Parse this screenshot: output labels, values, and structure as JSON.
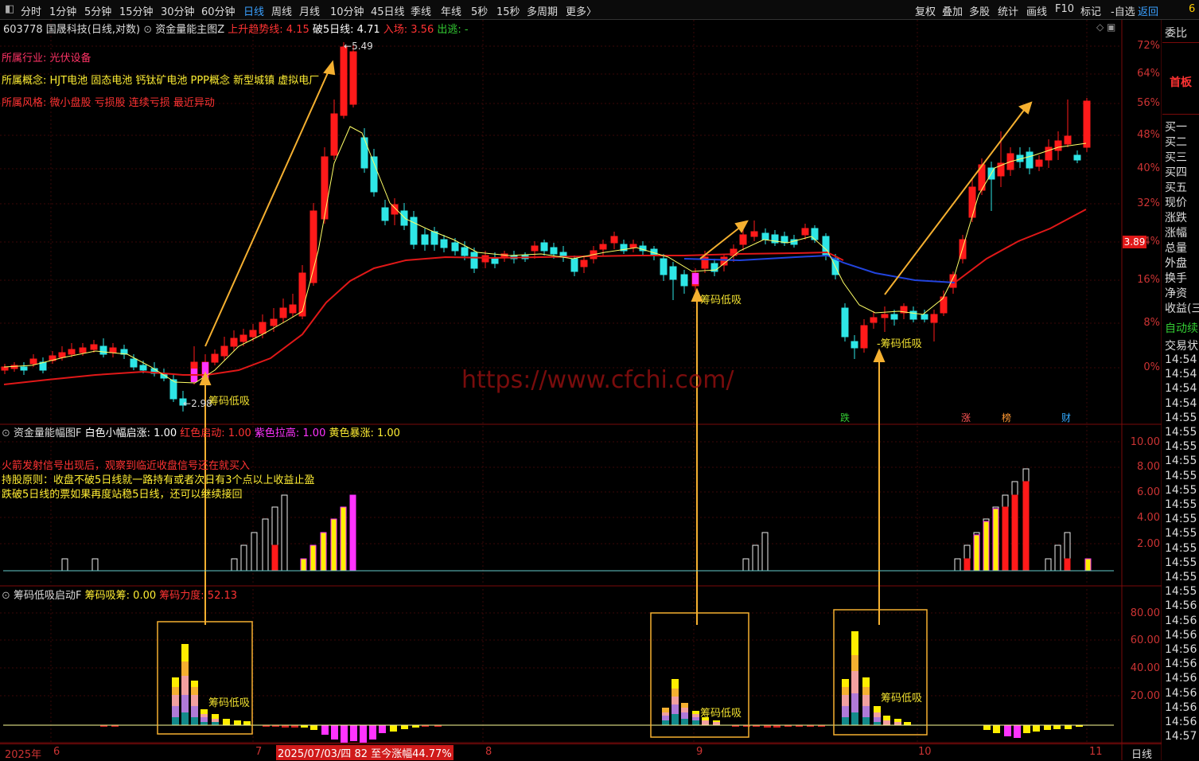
{
  "toolbar": {
    "left_icon": "◧",
    "periods": [
      "分时",
      "1分钟",
      "5分钟",
      "15分钟",
      "30分钟",
      "60分钟",
      "日线",
      "周线",
      "月线",
      "10分钟",
      "45日线",
      "季线",
      "年线",
      "5秒",
      "15秒",
      "多周期",
      "更多〉"
    ],
    "active_period": "日线",
    "right_items": [
      "复权",
      "叠加",
      "多股",
      "统计",
      "画线",
      "F10",
      "标记",
      "-自选",
      "返回"
    ],
    "corner": "6"
  },
  "main_panel": {
    "stock": "603778 国晟科技(日线,对数)",
    "indicator_name": "资金量能主图Z",
    "up_trend": "上升趋势线: 4.15",
    "break5": "破5日线: 4.71",
    "entry": "入场: 3.56",
    "exit": "出逃: -",
    "industry_label": "所属行业:",
    "industry_value": "光伏设备",
    "concept_label": "所属概念:",
    "concept_value": "HJT电池 固态电池 钙钛矿电池 PPP概念 新型城镇 虚拟电厂",
    "style_label": "所属风格:",
    "style_value": "微小盘股 亏损股 连续亏损 最近异动",
    "high_label": "5.49",
    "low_label": "2.98",
    "signal_label": "筹码低吸",
    "signal_label_dash": "-筹码低吸",
    "price_tag": "3.89",
    "y_axis": [
      "72%",
      "64%",
      "56%",
      "48%",
      "40%",
      "32%",
      "24%",
      "16%",
      "8%",
      "0%"
    ],
    "event_tags": [
      "跌",
      "涨",
      "榜",
      "财"
    ],
    "watermark": "https://www.cfchi.com/"
  },
  "volume_panel": {
    "title": "资金量能幅图F",
    "white": "白色小幅启涨: 1.00",
    "red": "红色启动: 1.00",
    "purple": "紫色拉高: 1.00",
    "yellow": "黄色暴涨: 1.00",
    "note1": "火箭发射信号出现后，观察到临近收盘信号还在就买入",
    "note2": "持股原则：收盘不破5日线就一路持有或者次日有3个点以上收益止盈",
    "note3": "跌破5日线的票如果再度站稳5日线，还可以继续接回",
    "y_axis": [
      "10.00",
      "8.00",
      "6.00",
      "4.00",
      "2.00"
    ]
  },
  "chip_panel": {
    "title": "筹码低吸启动F",
    "absorb": "筹码吸筹: 0.00",
    "power": "筹码力度: 52.13",
    "y_axis": [
      "80.00",
      "60.00",
      "40.00",
      "20.00"
    ]
  },
  "date_axis": {
    "year": "2025年",
    "months": [
      "6",
      "7",
      "8",
      "9",
      "10",
      "11"
    ],
    "highlight": "2025/07/03/四 82 至今涨幅44.77%",
    "period": "日线"
  },
  "side_panel": {
    "weibi": "委比",
    "shouban": "首板",
    "rows": [
      "买一",
      "买二",
      "买三",
      "买四",
      "买五",
      "现价",
      "涨跌",
      "涨幅",
      "总量",
      "外盘",
      "换手",
      "净资",
      "收益(三"
    ],
    "auto": "自动续",
    "trade": "交易状",
    "times": [
      "14:54",
      "14:54",
      "14:54",
      "14:54",
      "14:55",
      "14:55",
      "14:55",
      "14:55",
      "14:55",
      "14:55",
      "14:55",
      "14:55",
      "14:55",
      "14:55",
      "14:55",
      "14:55",
      "14:55",
      "14:56",
      "14:56",
      "14:56",
      "14:56",
      "14:56",
      "14:56",
      "14:56",
      "14:56",
      "14:56",
      "14:57"
    ]
  },
  "colors": {
    "up": "#ff1a1a",
    "down": "#2ee6e6",
    "ma": "#ffff66",
    "trend": "#e01818",
    "blue": "#2244dd",
    "arrow": "#f5b030",
    "magenta": "#ff33ff",
    "yellow": "#ffee00"
  }
}
